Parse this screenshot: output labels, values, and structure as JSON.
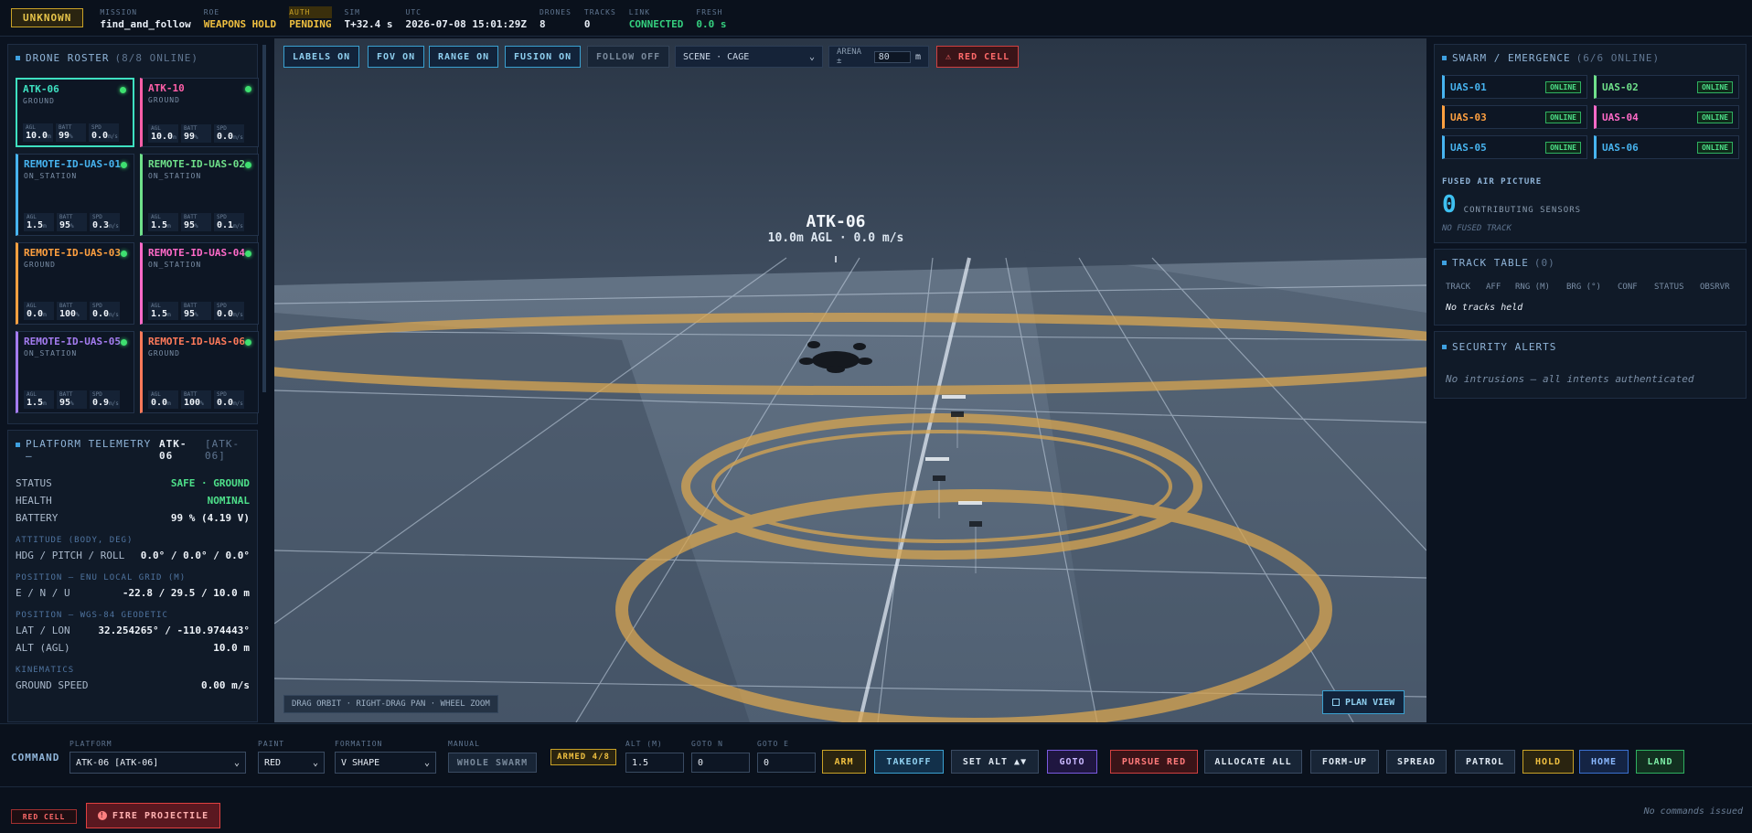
{
  "topbar": {
    "mode": "UNKNOWN",
    "stats": [
      {
        "k": "MISSION",
        "v": "find_and_follow",
        "cls": ""
      },
      {
        "k": "ROE",
        "v": "WEAPONS HOLD",
        "cls": "yellow"
      },
      {
        "k": "AUTH",
        "v": "PENDING",
        "cls": "yellow",
        "khl": true
      },
      {
        "k": "SIM",
        "v": "T+32.4 s",
        "cls": ""
      },
      {
        "k": "UTC",
        "v": "2026-07-08 15:01:29Z",
        "cls": ""
      },
      {
        "k": "DRONES",
        "v": "8",
        "cls": ""
      },
      {
        "k": "TRACKS",
        "v": "0",
        "cls": ""
      },
      {
        "k": "LINK",
        "v": "CONNECTED",
        "cls": "green"
      },
      {
        "k": "FRESH",
        "v": "0.0 s",
        "cls": "green"
      }
    ]
  },
  "roster": {
    "title": "DRONE ROSTER",
    "count": "(8/8 ONLINE)",
    "metric_labels": {
      "agl": "AGL",
      "batt": "BATT",
      "spd": "SPD"
    },
    "units": {
      "agl": "m",
      "batt": "%",
      "spd": "m/s"
    },
    "drones": [
      {
        "name": "ATK-06",
        "state": "GROUND",
        "agl": "10.0",
        "batt": "99",
        "spd": "0.0",
        "color": "#3ee0c0",
        "selected": true
      },
      {
        "name": "ATK-10",
        "state": "GROUND",
        "agl": "10.0",
        "batt": "99",
        "spd": "0.0",
        "color": "#ff5fa8",
        "selected": false
      },
      {
        "name": "REMOTE-ID-UAS-01",
        "state": "ON_STATION",
        "agl": "1.5",
        "batt": "95",
        "spd": "0.3",
        "color": "#47b4f0",
        "selected": false
      },
      {
        "name": "REMOTE-ID-UAS-02",
        "state": "ON_STATION",
        "agl": "1.5",
        "batt": "95",
        "spd": "0.1",
        "color": "#6fe08a",
        "selected": false
      },
      {
        "name": "REMOTE-ID-UAS-03",
        "state": "GROUND",
        "agl": "0.0",
        "batt": "100",
        "spd": "0.0",
        "color": "#ffa040",
        "selected": false
      },
      {
        "name": "REMOTE-ID-UAS-04",
        "state": "ON_STATION",
        "agl": "1.5",
        "batt": "95",
        "spd": "0.0",
        "color": "#ff6ac8",
        "selected": false
      },
      {
        "name": "REMOTE-ID-UAS-05",
        "state": "ON_STATION",
        "agl": "1.5",
        "batt": "95",
        "spd": "0.9",
        "color": "#a47cf0",
        "selected": false
      },
      {
        "name": "REMOTE-ID-UAS-06",
        "state": "GROUND",
        "agl": "0.0",
        "batt": "100",
        "spd": "0.0",
        "color": "#ff7a5a",
        "selected": false
      }
    ]
  },
  "telemetry": {
    "title": "PLATFORM TELEMETRY —",
    "drone": "ATK-06",
    "tag": "[ATK-06]",
    "status_label": "STATUS",
    "status": "SAFE · GROUND",
    "health_label": "HEALTH",
    "health": "NOMINAL",
    "battery_label": "BATTERY",
    "battery": "99 % (4.19 V)",
    "attitude_sec": "ATTITUDE (BODY, DEG)",
    "hpr_label": "HDG / PITCH / ROLL",
    "hpr": "0.0° / 0.0° / 0.0°",
    "enu_sec": "POSITION — ENU LOCAL GRID (M)",
    "enu_label": "E / N / U",
    "enu": "-22.8 / 29.5 / 10.0 m",
    "wgs_sec": "POSITION — WGS-84 GEODETIC",
    "latlon_label": "LAT / LON",
    "latlon": "32.254265° / -110.974443°",
    "alt_label": "ALT (AGL)",
    "alt": "10.0 m",
    "kin_sec": "KINEMATICS",
    "gs_label": "GROUND SPEED",
    "gs": "0.00 m/s"
  },
  "viewport": {
    "buttons": {
      "labels": "LABELS ON",
      "fov": "FOV ON",
      "range": "RANGE ON",
      "fusion": "FUSION ON",
      "follow": "FOLLOW OFF"
    },
    "scene": "SCENE · CAGE",
    "arena_label": "ARENA ±",
    "arena_value": "80",
    "arena_unit": "m",
    "red_cell": "⚠ RED CELL",
    "drone_label": "ATK-06",
    "drone_sub": "10.0m AGL · 0.0 m/s",
    "hint": "DRAG ORBIT · RIGHT-DRAG PAN · WHEEL ZOOM",
    "plan_view": "PLAN VIEW"
  },
  "swarm": {
    "title": "SWARM / EMERGENCE",
    "count": "(6/6 ONLINE)",
    "units": [
      {
        "name": "UAS-01",
        "status": "ONLINE",
        "color": "#47b4f0"
      },
      {
        "name": "UAS-02",
        "status": "ONLINE",
        "color": "#6fe08a"
      },
      {
        "name": "UAS-03",
        "status": "ONLINE",
        "color": "#ffa040"
      },
      {
        "name": "UAS-04",
        "status": "ONLINE",
        "color": "#ff6ac8"
      },
      {
        "name": "UAS-05",
        "status": "ONLINE",
        "color": "#47b4f0"
      },
      {
        "name": "UAS-06",
        "status": "ONLINE",
        "color": "#47b4f0"
      }
    ],
    "fused_title": "FUSED AIR PICTURE",
    "fused_count": "0",
    "fused_label": "CONTRIBUTING SENSORS",
    "fused_empty": "NO FUSED TRACK"
  },
  "tracks": {
    "title": "TRACK TABLE",
    "count": "(0)",
    "headers": [
      "TRACK",
      "AFF",
      "RNG (M)",
      "BRG (°)",
      "CONF",
      "STATUS",
      "OBSRVR"
    ],
    "empty": "No tracks held"
  },
  "security": {
    "title": "SECURITY ALERTS",
    "empty": "No intrusions — all intents authenticated"
  },
  "command": {
    "label": "COMMAND",
    "platform_label": "PLATFORM",
    "platform": "ATK-06 [ATK-06]",
    "paint_label": "PAINT",
    "paint": "RED",
    "formation_label": "FORMATION",
    "formation": "V SHAPE",
    "manual_label": "MANUAL",
    "manual": "WHOLE SWARM",
    "armed": "ARMED 4/8",
    "alt_label": "ALT (M)",
    "alt": "1.5",
    "goto_n_label": "GOTO N",
    "goto_n": "0",
    "goto_e_label": "GOTO E",
    "goto_e": "0",
    "arm": "ARM",
    "takeoff": "TAKEOFF",
    "set_alt": "SET ALT ▲▼",
    "goto": "GOTO",
    "pursue": "PURSUE RED",
    "allocate": "ALLOCATE ALL",
    "formup": "FORM-UP",
    "spread": "SPREAD",
    "patrol": "PATROL",
    "hold": "HOLD",
    "home": "HOME",
    "land": "LAND",
    "red_cell_tag": "RED CELL",
    "fire": "FIRE PROJECTILE",
    "log_empty": "No commands issued"
  },
  "colors": {
    "accent": "#3aa0e0",
    "ok": "#35d07f",
    "warn": "#f0c040",
    "danger": "#d04040"
  }
}
